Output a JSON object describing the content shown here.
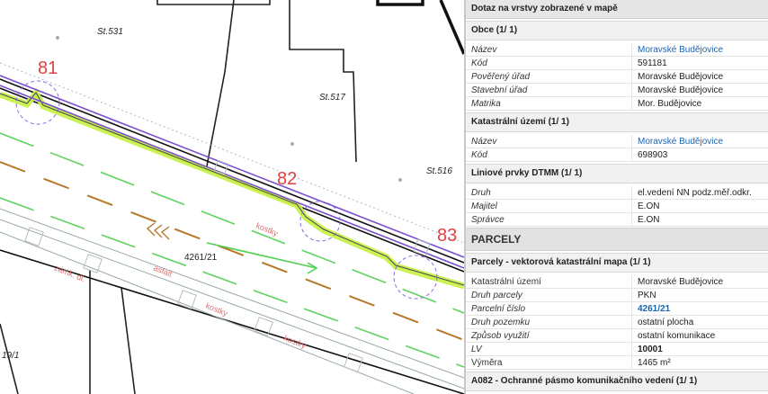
{
  "map": {
    "parcel_labels": [
      "St.531",
      "St.517",
      "St.516",
      "4261/21",
      "19/1"
    ],
    "point_labels": [
      "81",
      "82",
      "83"
    ],
    "road_labels": [
      "zámk. dl.",
      "asfalt",
      "kostky",
      "kostky",
      "kostky"
    ]
  },
  "panel": {
    "title": "Dotaz na vrstvy zobrazené v mapě",
    "obce": {
      "header": "Obce (1/ 1)",
      "rows": [
        {
          "k": "Název",
          "v": "Moravské Budějovice"
        },
        {
          "k": "Kód",
          "v": "591181"
        },
        {
          "k": "Pověřený úřad",
          "v": "Moravské Budějovice"
        },
        {
          "k": "Stavební úřad",
          "v": "Moravské Budějovice"
        },
        {
          "k": "Matrika",
          "v": "Mor. Budějovice"
        }
      ]
    },
    "katastr": {
      "header": "Katastrální území (1/ 1)",
      "rows": [
        {
          "k": "Název",
          "v": "Moravské Budějovice"
        },
        {
          "k": "Kód",
          "v": "698903"
        }
      ]
    },
    "dtmm": {
      "header": "Liniové prvky DTMM (1/ 1)",
      "rows": [
        {
          "k": "Druh",
          "v": "el.vedení NN podz.měř.odkr."
        },
        {
          "k": "Majitel",
          "v": "E.ON"
        },
        {
          "k": "Správce",
          "v": "E.ON"
        }
      ]
    },
    "parcely": {
      "big_header": "PARCELY",
      "header": "Parcely - vektorová katastrální mapa (1/ 1)",
      "rows": [
        {
          "k": "Katastrální území",
          "v": "Moravské Budějovice"
        },
        {
          "k": "Druh parcely",
          "v": "PKN"
        },
        {
          "k": "Parcelní číslo",
          "v": "4261/21"
        },
        {
          "k": "Druh pozemku",
          "v": "ostatní plocha"
        },
        {
          "k": "Způsob využití",
          "v": "ostatní komunikace"
        },
        {
          "k": "LV",
          "v": "10001"
        },
        {
          "k": "Výměra",
          "v": "1465 m²"
        }
      ]
    },
    "a082": {
      "header": "A082 - Ochranné pásmo komunikačního vedení (1/ 1)"
    }
  }
}
